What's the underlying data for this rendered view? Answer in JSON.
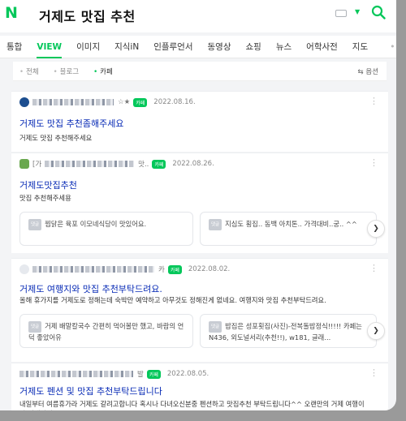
{
  "search": {
    "logo": "N",
    "query": "거제도 맛집 추천"
  },
  "tabs": [
    "통합",
    "VIEW",
    "이미지",
    "지식iN",
    "인플루언서",
    "동영상",
    "쇼핑",
    "뉴스",
    "어학사전",
    "지도"
  ],
  "tabs_more": "•••",
  "filters": {
    "items": [
      "전체",
      "블로그",
      "카페"
    ],
    "options": "옵션"
  },
  "colors": {
    "brand": "#03c75a",
    "link": "#0629b5"
  },
  "results": [
    {
      "author_suffix": "☆★",
      "badge": "카페",
      "date": "2022.08.16.",
      "title": "거제도 맛집 추천좀해주세요",
      "desc": "거제도 맛집 추천해주세요"
    },
    {
      "author_prefix": "[가",
      "author_suffix": "맛..",
      "badge": "카페",
      "date": "2022.08.26.",
      "title": "거제도맛집추천",
      "desc": "맛집 추천해주세용",
      "subs": [
        {
          "tag": "댓글",
          "text": "찜닭은 육포 이모네식당이 맛있어요."
        },
        {
          "tag": "댓글",
          "text": "지심도 횡집.. 동백 아치톤.. 가격대비..궁.. ^^"
        }
      ]
    },
    {
      "author_suffix": "카",
      "badge": "카페",
      "date": "2022.08.02.",
      "title": "거제도 여행지와 맛집 추천부탁드려요.",
      "desc": "올해 휴가지를 거제도로 정해는데 숙박만 예약하고 아무것도 정해진게 없네요. 여행지와 맛집 추천부탁드려요.",
      "subs": [
        {
          "tag": "댓글",
          "text": "거제 배말칼국수 간편히 먹어볼만 했고, 바람의 언덕 좋았어유"
        },
        {
          "tag": "댓글",
          "text": "밥집은 성포횟집(사진)-전복돌밥정식!!!!! 카페는 N436, 외도널서리(추천!!), w181, 글래..."
        }
      ]
    },
    {
      "author_suffix": "발",
      "badge": "카페",
      "date": "2022.08.05.",
      "title": "거제도 펜션 및 맛집 추천부탁드립니다",
      "desc": "내일부터 여름휴가라 거제도 갈려고합니다 혹시나 다녀오신분중 펜션하고 맛집추천 부탁드립니다^^ 오랜만의 거제 여행이라 설레이네요="
    }
  ]
}
